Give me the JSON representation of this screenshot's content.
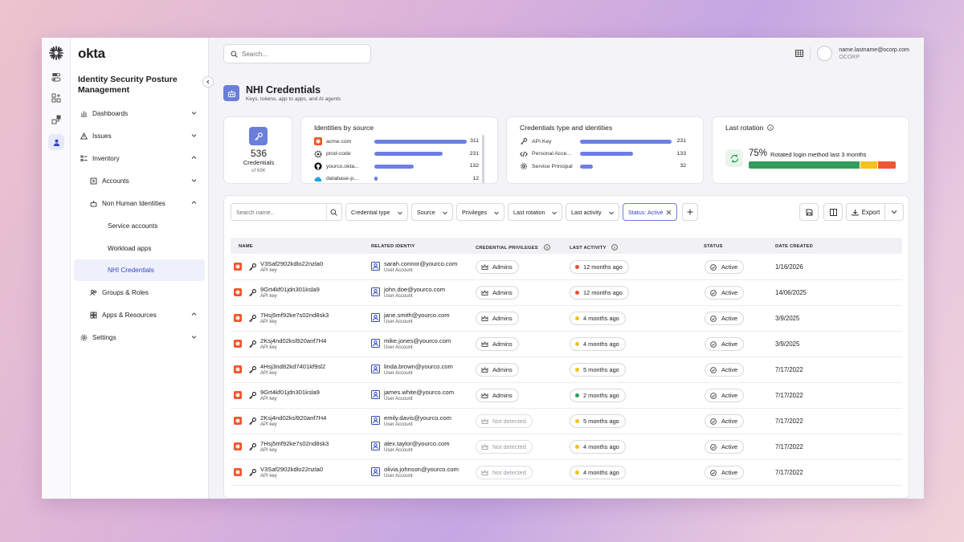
{
  "app": {
    "logo": "okta",
    "title": "Identity Security Posture Management"
  },
  "nav": [
    {
      "label": "Dashboards"
    },
    {
      "label": "Issues"
    },
    {
      "label": "Inventory"
    },
    {
      "label": "Accounts"
    },
    {
      "label": "Non Human Identities"
    },
    {
      "label": "Service accounts"
    },
    {
      "label": "Workload apps"
    },
    {
      "label": "NHI Credentials"
    },
    {
      "label": "Groups & Roles"
    },
    {
      "label": "Apps & Resources"
    },
    {
      "label": "Settings"
    }
  ],
  "header": {
    "search_placeholder": "Search...",
    "user_email": "name.lastname@ocorp.com",
    "user_org": "OCORP"
  },
  "page": {
    "title": "NHI Credentials",
    "subtitle": "Keys, tokens, app to apps, and AI agents"
  },
  "summary": {
    "count": "536",
    "label": "Credentials",
    "of": "of 69K"
  },
  "identities_by_source": {
    "title": "Identities by source",
    "items": [
      {
        "name": "acme.com",
        "value": 311,
        "value_label": "311"
      },
      {
        "name": "prod-code",
        "value": 231,
        "value_label": "231"
      },
      {
        "name": "yourco.okta...",
        "value": 132,
        "value_label": "132"
      },
      {
        "name": "database-p...",
        "value": 12,
        "value_label": "12"
      }
    ],
    "max": 311
  },
  "cred_types": {
    "title": "Credentials type and identities",
    "items": [
      {
        "name": "API Key",
        "value": 231,
        "value_label": "231"
      },
      {
        "name": "Personal Acce...",
        "value": 133,
        "value_label": "133"
      },
      {
        "name": "Service Principal",
        "value": 32,
        "value_label": "32"
      }
    ],
    "max": 231
  },
  "last_rotation": {
    "title": "Last rotation",
    "percent_label": "75%",
    "caption": "Rotated login method last 3 months",
    "segments": [
      {
        "fraction": 0.765,
        "color": "#2e9e5b"
      },
      {
        "fraction": 0.115,
        "color": "#f4c21b"
      },
      {
        "fraction": 0.12,
        "color": "#ef5634"
      }
    ]
  },
  "toolbar": {
    "search_placeholder": "Search name..",
    "filters": [
      "Credential type",
      "Source",
      "Privileges",
      "Last rotation",
      "Last activity"
    ],
    "active_filter": "Status: Active",
    "export_label": "Export"
  },
  "columns": [
    "NAME",
    "RELATED IDENTIY",
    "CREDENTIAL PRIVILEGES",
    "LAST ACTIVITY",
    "STATUS",
    "DATE CREATED"
  ],
  "colors": {
    "red": "#ef4d2f",
    "yellow": "#f4c21b",
    "green": "#2e9e5b",
    "accent": "#6b7fd9"
  },
  "rows": [
    {
      "name": "V3Saf2902kdlo22nzla0",
      "type": "API key",
      "email": "sarah.connor@yourco.com",
      "acct": "User Account",
      "priv": "Admins",
      "detected": true,
      "activity": "12 months ago",
      "dot": "#ef4d2f",
      "status": "Active",
      "date": "1/16/2026"
    },
    {
      "name": "9Grt4kf01jdn301ksla9",
      "type": "API key",
      "email": "john.doe@yourco.com",
      "acct": "User Account",
      "priv": "Admins",
      "detected": true,
      "activity": "12 months ago",
      "dot": "#ef4d2f",
      "status": "Active",
      "date": "14/06/2025"
    },
    {
      "name": "7Hsj5mf92ke7s02nd8sk3",
      "type": "API key",
      "email": "jane.smith@yourco.com",
      "acct": "User Account",
      "priv": "Admins",
      "detected": true,
      "activity": "4 months ago",
      "dot": "#f4c21b",
      "status": "Active",
      "date": "3/9/2025"
    },
    {
      "name": "2Ksj4nd02ksl920anf7H4",
      "type": "API key",
      "email": "mike.jones@yourco.com",
      "acct": "User Account",
      "priv": "Admins",
      "detected": true,
      "activity": "4 months ago",
      "dot": "#f4c21b",
      "status": "Active",
      "date": "3/9/2025"
    },
    {
      "name": "4Hsj3nd82kd7401kf9sl2",
      "type": "API key",
      "email": "linda.brown@yourco.com",
      "acct": "User Account",
      "priv": "Admins",
      "detected": true,
      "activity": "5 months ago",
      "dot": "#f4c21b",
      "status": "Active",
      "date": "7/17/2022"
    },
    {
      "name": "9Grt4kf01jdn301ksla9",
      "type": "API key",
      "email": "james.white@yourco.com",
      "acct": "User Account",
      "priv": "Admins",
      "detected": true,
      "activity": "2 months ago",
      "dot": "#2e9e5b",
      "status": "Active",
      "date": "7/17/2022"
    },
    {
      "name": "2Ksj4nd02ksl920anf7H4",
      "type": "API key",
      "email": "emily.davis@yourco.com",
      "acct": "User Account",
      "priv": "Not detected",
      "detected": false,
      "activity": "5 months ago",
      "dot": "#f4c21b",
      "status": "Active",
      "date": "7/17/2022"
    },
    {
      "name": "7Hsj5mf92ke7s02nd8sk3",
      "type": "API key",
      "email": "alex.taylor@yourco.com",
      "acct": "User Account",
      "priv": "Not detected",
      "detected": false,
      "activity": "4 months ago",
      "dot": "#f4c21b",
      "status": "Active",
      "date": "7/17/2022"
    },
    {
      "name": "V3Saf2902kdlo22nzla0",
      "type": "API key",
      "email": "olivia.johnson@yourco.com",
      "acct": "User Account",
      "priv": "Not detected",
      "detected": false,
      "activity": "4 months ago",
      "dot": "#f4c21b",
      "status": "Active",
      "date": "7/17/2022"
    }
  ]
}
